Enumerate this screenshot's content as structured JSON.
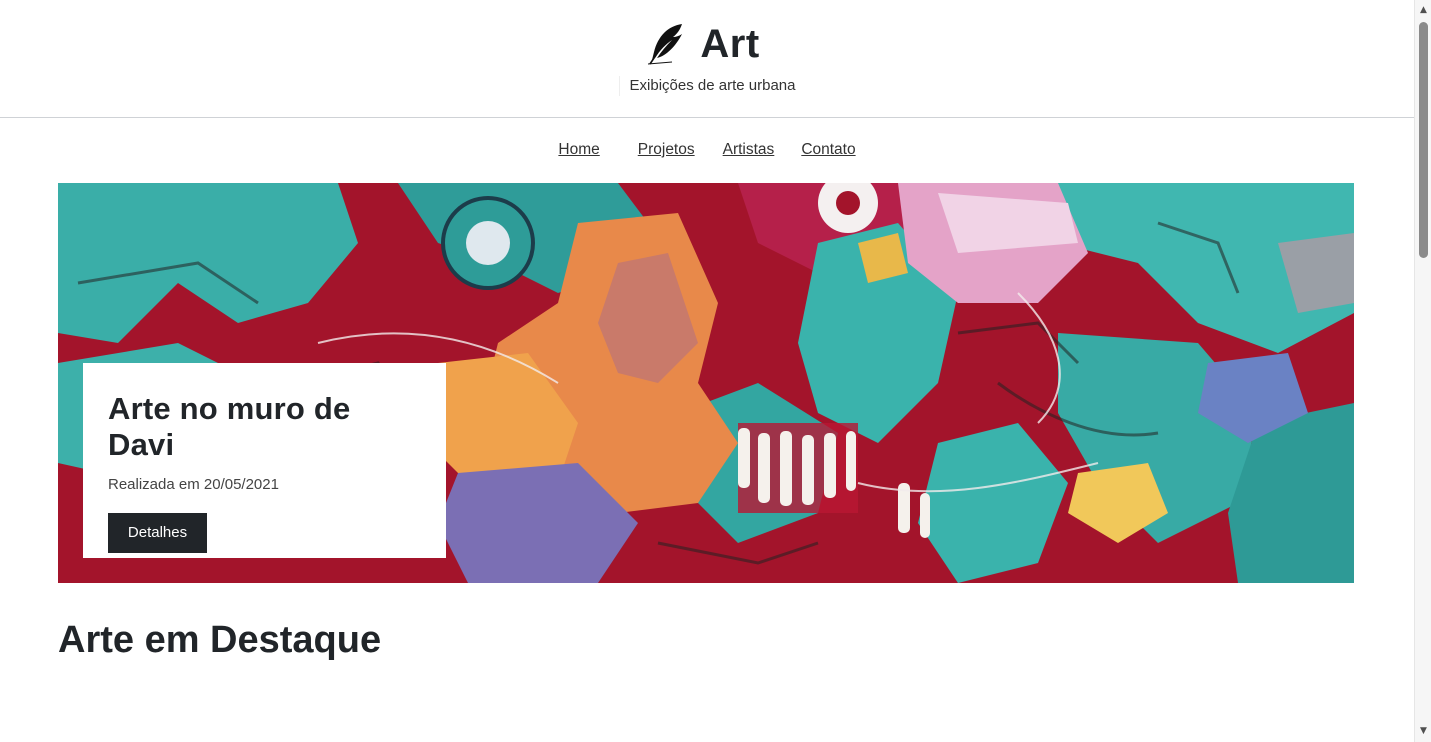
{
  "header": {
    "icon": "feather-icon",
    "title": "Art",
    "subtitle": "Exibições de arte urbana"
  },
  "nav": {
    "items": [
      {
        "label": "Home"
      },
      {
        "label": "Projetos"
      },
      {
        "label": "Artistas"
      },
      {
        "label": "Contato"
      }
    ]
  },
  "hero": {
    "image": "graffiti-mural-image",
    "title": "Arte no muro de Davi",
    "date": "Realizada em 20/05/2021",
    "button_label": "Detalhes"
  },
  "featured": {
    "title": "Arte em Destaque"
  },
  "colors": {
    "text": "#212529",
    "button_bg": "#212529",
    "mural_red": "#b3122c",
    "mural_teal": "#3ab3ac",
    "mural_orange": "#e8894a"
  },
  "scrollbar": {
    "up_icon": "scroll-up-arrow-icon",
    "down_icon": "scroll-down-arrow-icon"
  }
}
